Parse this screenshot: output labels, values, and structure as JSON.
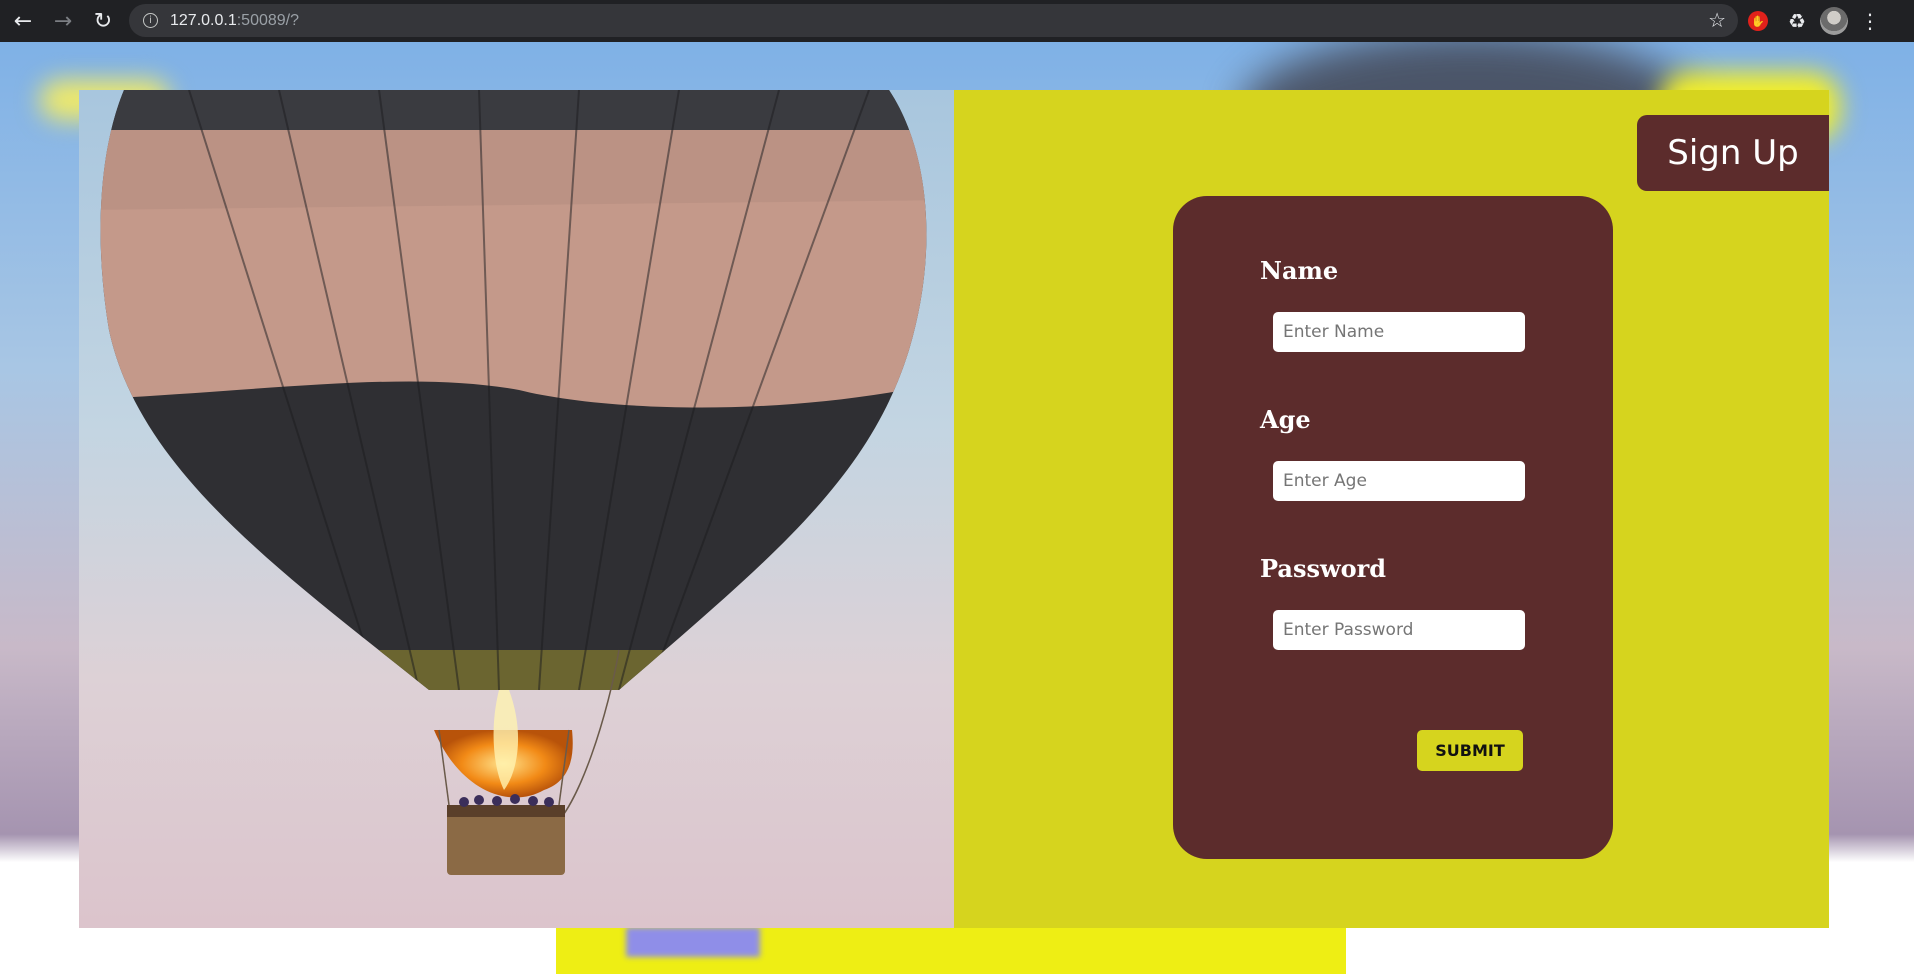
{
  "browser": {
    "back_icon": "arrow-left-icon",
    "forward_icon": "arrow-right-icon",
    "reload_icon": "reload-icon",
    "url_host": "127.0.0.1",
    "url_rest": ":50089/?",
    "bookmark_icon": "star-icon",
    "extensions": [
      "stop-hand-icon",
      "puzzle-icon"
    ],
    "menu_icon": "kebab-menu-icon"
  },
  "page": {
    "signup_title": "Sign Up",
    "form": {
      "name_label": "Name",
      "name_placeholder": "Enter Name",
      "age_label": "Age",
      "age_placeholder": "Enter Age",
      "password_label": "Password",
      "password_placeholder": "Enter Password",
      "submit_label": "SUBMIT"
    },
    "colors": {
      "panel": "#d6d41e",
      "form_box": "#5c2c2c",
      "submit": "#d6d41e"
    }
  }
}
